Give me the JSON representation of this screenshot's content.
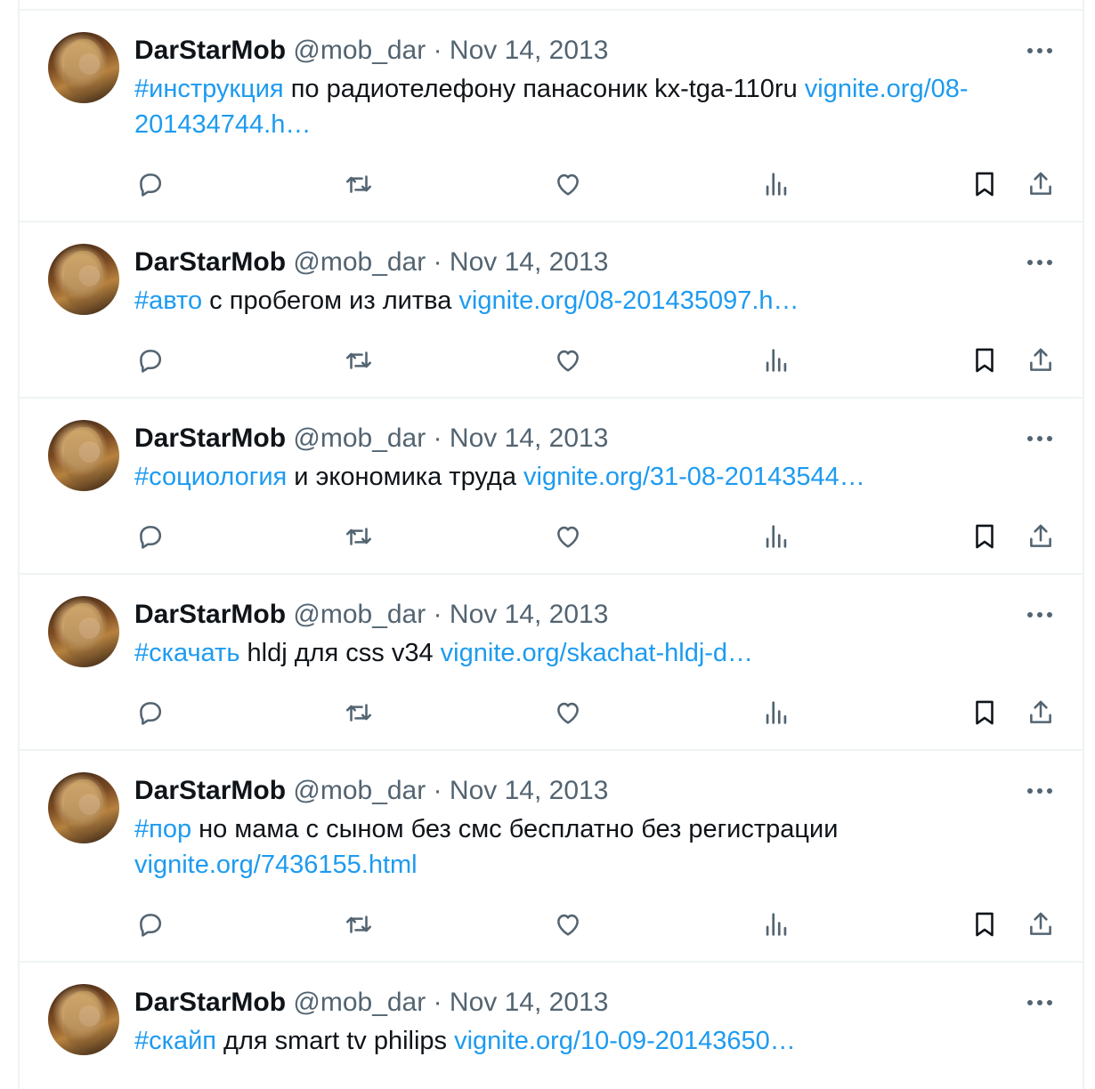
{
  "feed": {
    "tweets": [
      {
        "name": "DarStarMob",
        "handle": "@mob_dar",
        "sep": "·",
        "date": "Nov 14, 2013",
        "hashtag": "#инструкция",
        "text": " по радиотелефону панасоник kx-tga-110ru ",
        "link": "vignite.org/08-201434744.h…"
      },
      {
        "name": "DarStarMob",
        "handle": "@mob_dar",
        "sep": "·",
        "date": "Nov 14, 2013",
        "hashtag": "#авто",
        "text": " с пробегом из литва ",
        "link": "vignite.org/08-201435097.h…"
      },
      {
        "name": "DarStarMob",
        "handle": "@mob_dar",
        "sep": "·",
        "date": "Nov 14, 2013",
        "hashtag": "#социология",
        "text": " и экономика труда ",
        "link": "vignite.org/31-08-20143544…"
      },
      {
        "name": "DarStarMob",
        "handle": "@mob_dar",
        "sep": "·",
        "date": "Nov 14, 2013",
        "hashtag": "#скачать",
        "text": " hldj для css v34 ",
        "link": "vignite.org/skachat-hldj-d…"
      },
      {
        "name": "DarStarMob",
        "handle": "@mob_dar",
        "sep": "·",
        "date": "Nov 14, 2013",
        "hashtag": "#пор",
        "text": " но мама с сыном без смс бесплатно без регистрации ",
        "link": "vignite.org/7436155.html"
      },
      {
        "name": "DarStarMob",
        "handle": "@mob_dar",
        "sep": "·",
        "date": "Nov 14, 2013",
        "hashtag": "#скайп",
        "text": " для smart tv philips ",
        "link": "vignite.org/10-09-20143650…"
      }
    ]
  },
  "icons": {
    "more": "more-horizontal-icon",
    "reply": "reply-icon",
    "retweet": "retweet-icon",
    "like": "like-icon",
    "views": "views-icon",
    "bookmark": "bookmark-icon",
    "share": "share-icon"
  },
  "colors": {
    "text": "#0f1419",
    "secondary": "#536471",
    "link": "#1d9bf0",
    "divider": "#eff3f4"
  }
}
